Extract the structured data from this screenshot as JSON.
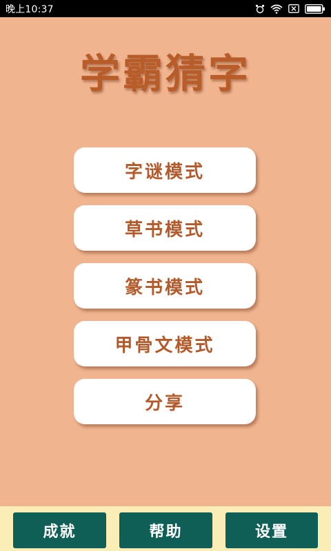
{
  "status_bar": {
    "time": "晚上10:37",
    "icons": [
      "alarm-icon",
      "wifi-icon",
      "sim-icon",
      "battery-icon"
    ]
  },
  "app": {
    "title": "学霸猜字"
  },
  "menu": {
    "items": [
      {
        "label": "字谜模式"
      },
      {
        "label": "草书模式"
      },
      {
        "label": "篆书模式"
      },
      {
        "label": "甲骨文模式"
      },
      {
        "label": "分享"
      }
    ]
  },
  "bottom_bar": {
    "achievements_label": "成就",
    "help_label": "帮助",
    "settings_label": "设置"
  },
  "colors": {
    "background": "#f0b48f",
    "title": "#b85c2a",
    "button_text": "#b45a2a",
    "bottom_bar_bg": "#faedb6",
    "bottom_button_bg": "#0f5f56"
  }
}
